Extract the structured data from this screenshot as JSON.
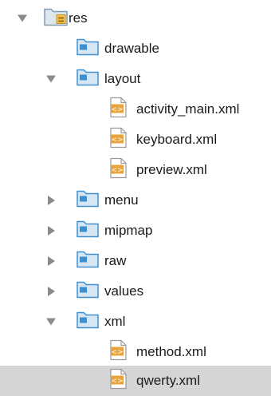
{
  "tree": {
    "root": {
      "label": "res",
      "expanded": true,
      "icon": "res-folder-icon"
    },
    "nodes": [
      {
        "label": "drawable",
        "type": "folder",
        "expanded": false,
        "has_children": false
      },
      {
        "label": "layout",
        "type": "folder",
        "expanded": true,
        "has_children": true
      },
      {
        "label": "activity_main.xml",
        "type": "xml-file"
      },
      {
        "label": "keyboard.xml",
        "type": "xml-file"
      },
      {
        "label": "preview.xml",
        "type": "xml-file"
      },
      {
        "label": "menu",
        "type": "folder",
        "expanded": false,
        "has_children": true
      },
      {
        "label": "mipmap",
        "type": "folder",
        "expanded": false,
        "has_children": true
      },
      {
        "label": "raw",
        "type": "folder",
        "expanded": false,
        "has_children": true
      },
      {
        "label": "values",
        "type": "folder",
        "expanded": false,
        "has_children": true
      },
      {
        "label": "xml",
        "type": "folder",
        "expanded": true,
        "has_children": true
      },
      {
        "label": "method.xml",
        "type": "xml-file"
      },
      {
        "label": "qwerty.xml",
        "type": "xml-file",
        "selected": true
      }
    ]
  },
  "colors": {
    "selection": "#d5d5d5",
    "arrow": "#8a8a8a",
    "folder_blue": "#3d8fd0",
    "xml_orange": "#e8a33d"
  }
}
